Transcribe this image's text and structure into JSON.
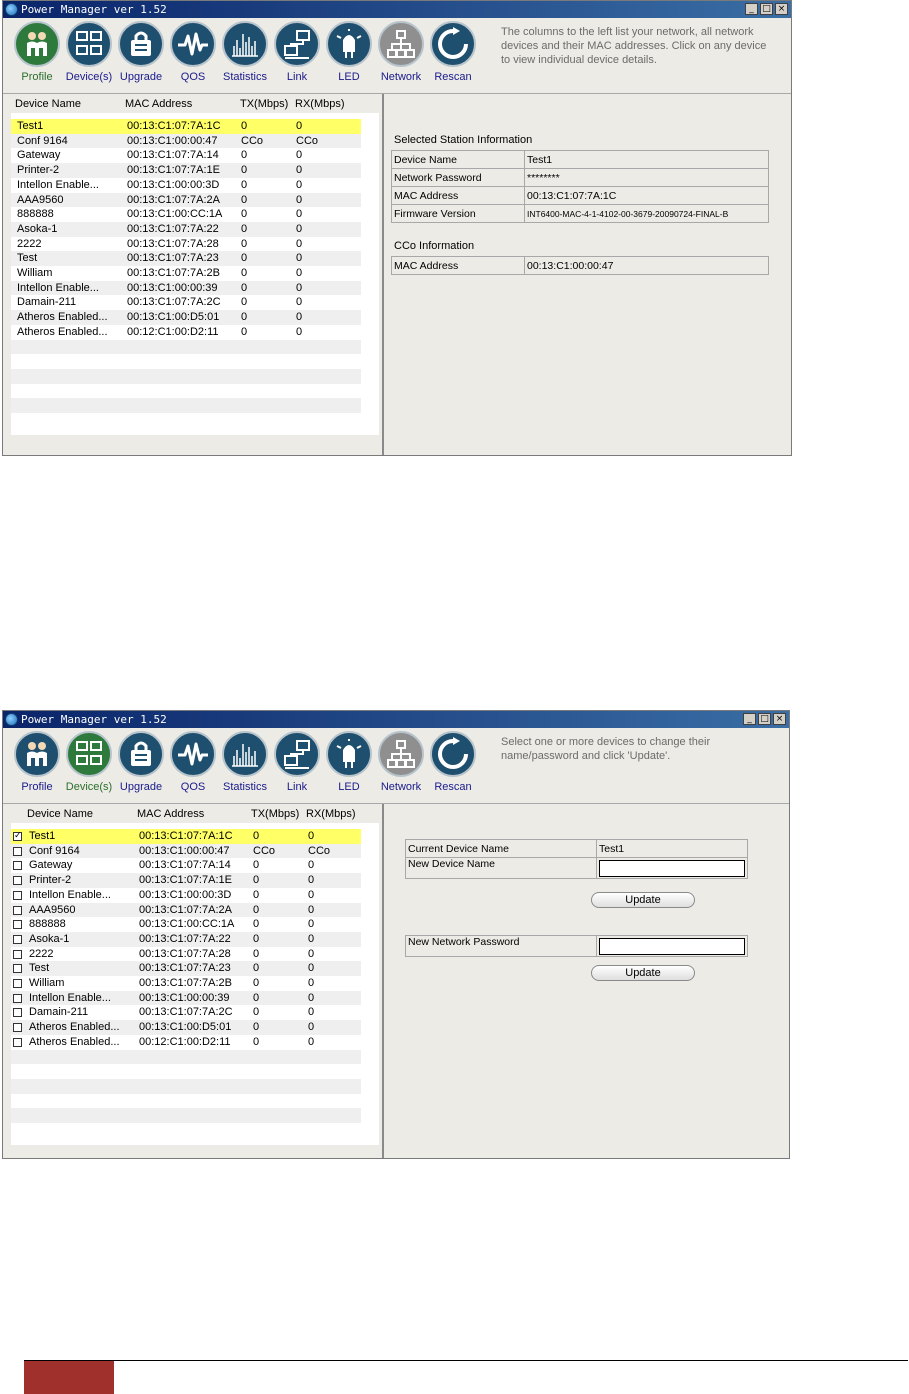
{
  "window1": {
    "title": "Power Manager ver 1.52",
    "help_text": "The columns to the left list your network, all network devices and their MAC addresses. Click on any device to view individual device details.",
    "columns": [
      "Device Name",
      "MAC Address",
      "TX(Mbps)",
      "RX(Mbps)"
    ],
    "selected_section_title": "Selected Station Information",
    "selected_info": [
      {
        "label": "Device Name",
        "value": "Test1"
      },
      {
        "label": "Network Password",
        "value": "********"
      },
      {
        "label": "MAC Address",
        "value": "00:13:C1:07:7A:1C"
      },
      {
        "label": "Firmware Version",
        "value": "INT6400-MAC-4-1-4102-00-3679-20090724-FINAL-B"
      }
    ],
    "cco_section_title": "CCo Information",
    "cco_info": [
      {
        "label": "MAC Address",
        "value": "00:13:C1:00:00:47"
      }
    ]
  },
  "window2": {
    "title": "Power Manager ver 1.52",
    "help_text": "Select one or more devices to change their name/password and click 'Update'.",
    "columns": [
      "Device Name",
      "MAC Address",
      "TX(Mbps)",
      "RX(Mbps)"
    ],
    "current_device_label": "Current Device Name",
    "current_device_value": "Test1",
    "new_device_name_label": "New Device Name",
    "new_network_password_label": "New Network Password",
    "update_label": "Update",
    "checked_row": 0
  },
  "toolbar": [
    {
      "label": "Profile",
      "icon": "profile-icon"
    },
    {
      "label": "Device(s)",
      "icon": "devices-icon"
    },
    {
      "label": "Upgrade",
      "icon": "upgrade-icon"
    },
    {
      "label": "QOS",
      "icon": "qos-icon"
    },
    {
      "label": "Statistics",
      "icon": "statistics-icon"
    },
    {
      "label": "Link",
      "icon": "link-icon"
    },
    {
      "label": "LED",
      "icon": "led-icon"
    },
    {
      "label": "Network",
      "icon": "network-icon"
    },
    {
      "label": "Rescan",
      "icon": "rescan-icon"
    }
  ],
  "devices": [
    {
      "name": "Test1",
      "mac": "00:13:C1:07:7A:1C",
      "tx": "0",
      "rx": "0"
    },
    {
      "name": "Conf 9164",
      "mac": "00:13:C1:00:00:47",
      "tx": "CCo",
      "rx": "CCo"
    },
    {
      "name": "Gateway",
      "mac": "00:13:C1:07:7A:14",
      "tx": "0",
      "rx": "0"
    },
    {
      "name": "Printer-2",
      "mac": "00:13:C1:07:7A:1E",
      "tx": "0",
      "rx": "0"
    },
    {
      "name": "Intellon Enable...",
      "mac": "00:13:C1:00:00:3D",
      "tx": "0",
      "rx": "0"
    },
    {
      "name": "AAA9560",
      "mac": "00:13:C1:07:7A:2A",
      "tx": "0",
      "rx": "0"
    },
    {
      "name": "888888",
      "mac": "00:13:C1:00:CC:1A",
      "tx": "0",
      "rx": "0"
    },
    {
      "name": "Asoka-1",
      "mac": "00:13:C1:07:7A:22",
      "tx": "0",
      "rx": "0"
    },
    {
      "name": "2222",
      "mac": "00:13:C1:07:7A:28",
      "tx": "0",
      "rx": "0"
    },
    {
      "name": "Test",
      "mac": "00:13:C1:07:7A:23",
      "tx": "0",
      "rx": "0"
    },
    {
      "name": "William",
      "mac": "00:13:C1:07:7A:2B",
      "tx": "0",
      "rx": "0"
    },
    {
      "name": "Intellon Enable...",
      "mac": "00:13:C1:00:00:39",
      "tx": "0",
      "rx": "0"
    },
    {
      "name": "Damain-211",
      "mac": "00:13:C1:07:7A:2C",
      "tx": "0",
      "rx": "0"
    },
    {
      "name": "Atheros Enabled...",
      "mac": "00:13:C1:00:D5:01",
      "tx": "0",
      "rx": "0"
    },
    {
      "name": "Atheros Enabled...",
      "mac": "00:12:C1:00:D2:11",
      "tx": "0",
      "rx": "0"
    }
  ],
  "colors": {
    "selected_row": "#ffff66",
    "active_tool": "#2e7a3c",
    "footer_block": "#a0302b"
  }
}
